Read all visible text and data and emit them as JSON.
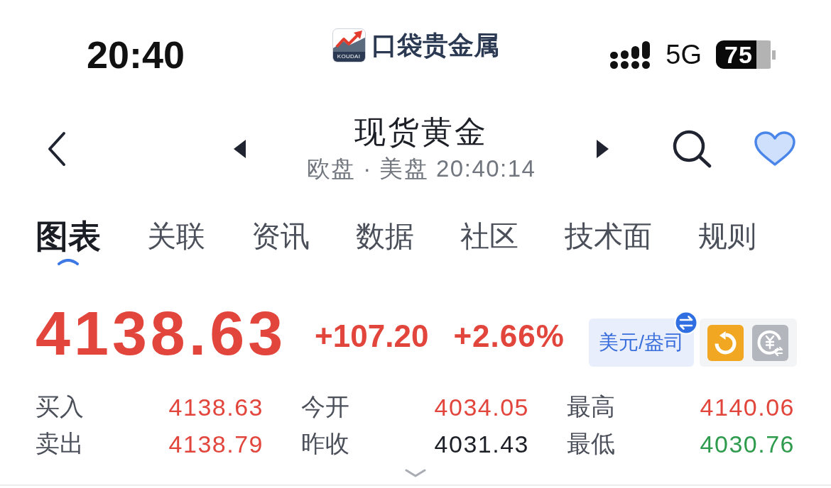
{
  "status_bar": {
    "time": "20:40",
    "network": "5G",
    "battery": "75"
  },
  "app_logo": {
    "badge": "KOUDAI",
    "name": "口袋贵金属"
  },
  "header": {
    "title": "现货黄金",
    "subtitle": "欧盘 · 美盘 20:40:14"
  },
  "tabs": [
    {
      "label": "图表",
      "selected": true
    },
    {
      "label": "关联",
      "selected": false
    },
    {
      "label": "资讯",
      "selected": false
    },
    {
      "label": "数据",
      "selected": false
    },
    {
      "label": "社区",
      "selected": false
    },
    {
      "label": "技术面",
      "selected": false
    },
    {
      "label": "规则",
      "selected": false
    }
  ],
  "quote": {
    "price": "4138.63",
    "change": "+107.20",
    "change_percent": "+2.66%",
    "color": "#e2453c",
    "unit": "美元/盎司"
  },
  "stats": [
    {
      "label": "买入",
      "value": "4138.63",
      "color": "#e2453c"
    },
    {
      "label": "今开",
      "value": "4034.05",
      "color": "#e2453c"
    },
    {
      "label": "最高",
      "value": "4140.06",
      "color": "#e2453c"
    },
    {
      "label": "卖出",
      "value": "4138.79",
      "color": "#e2453c"
    },
    {
      "label": "昨收",
      "value": "4031.43",
      "color": "#1c1f26"
    },
    {
      "label": "最低",
      "value": "4030.76",
      "color": "#2e9b4d"
    }
  ]
}
